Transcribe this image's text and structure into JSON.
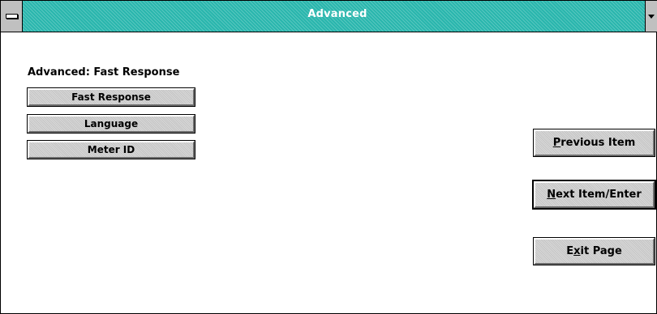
{
  "window": {
    "title": "Advanced"
  },
  "content": {
    "section_label": "Advanced: Fast Response",
    "menu_buttons": [
      {
        "label": "Fast Response"
      },
      {
        "label": "Language"
      },
      {
        "label": "Meter ID"
      }
    ],
    "nav_buttons": {
      "previous": {
        "mnemonic": "P",
        "rest": "revious Item"
      },
      "next": {
        "mnemonic": "N",
        "rest": "ext Item/Enter"
      },
      "exit": {
        "prefix": "E",
        "mnemonic": "x",
        "rest": "it Page"
      }
    }
  },
  "icons": {
    "system_menu": "system-menu-icon",
    "minimize": "minimize-icon"
  },
  "colors": {
    "titlebar": "#29b6ad",
    "button_face": "#c4c4c4",
    "window_bg": "#ffffff"
  }
}
